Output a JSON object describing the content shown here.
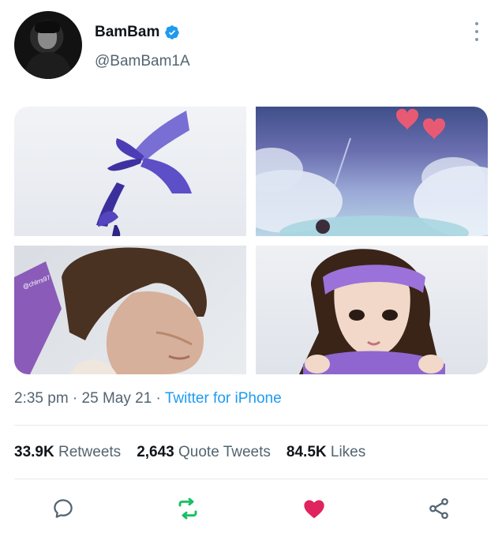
{
  "user": {
    "display_name": "BamBam",
    "handle": "@BamBam1A",
    "verified": true
  },
  "media": [
    {
      "label": "ribbon-image"
    },
    {
      "label": "sky-hearts-image"
    },
    {
      "label": "portrait-man-image",
      "watermark": "@chlrrs97"
    },
    {
      "label": "portrait-woman-ribbon-image"
    }
  ],
  "meta": {
    "time": "2:35 pm",
    "sep1": " · ",
    "date": "25 May 21",
    "sep2": " · ",
    "source": "Twitter for iPhone"
  },
  "stats": {
    "retweets_count": "33.9K",
    "retweets_label": "Retweets",
    "quotes_count": "2,643",
    "quotes_label": "Quote Tweets",
    "likes_count": "84.5K",
    "likes_label": "Likes"
  },
  "colors": {
    "retweet_green": "#17bf63",
    "like_red": "#e0245e",
    "link_blue": "#1d9bf0",
    "muted_gray": "#536471"
  }
}
